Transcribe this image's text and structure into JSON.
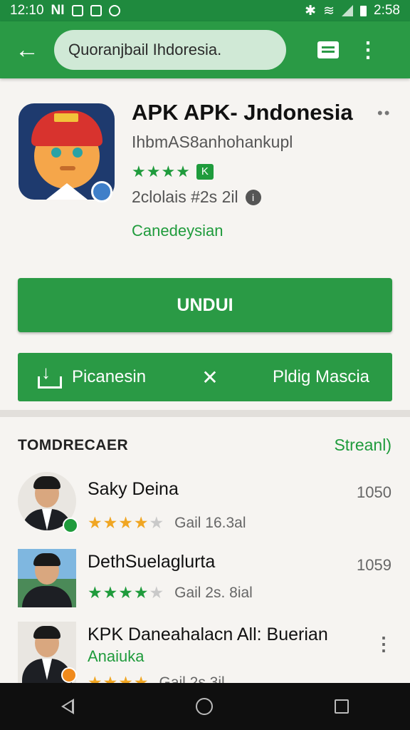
{
  "status_bar": {
    "time": "12:10",
    "carrier": "NI",
    "right_time": "2:58"
  },
  "app_bar": {
    "search_text": "Quoranjbail Ihdoresia."
  },
  "app": {
    "title": "APK APK- Jndonesia",
    "developer": "IhbmAS8anhohankupl",
    "stars": "★★★★",
    "badge": "K",
    "downloads": "2clolais #2s 2il",
    "category": "Canedeysian"
  },
  "buttons": {
    "install": "UNDUI",
    "left_action": "Picanesin",
    "separator": "✕",
    "right_action": "Pldig Mascia"
  },
  "section": {
    "title": "TOMDRECAER",
    "link": "Streanl)"
  },
  "list": [
    {
      "name": "Saky Deina",
      "rating_text": "Gail 16.3al",
      "number": "1050",
      "star_color": "#f0a623",
      "badge_color": "#1f9b3c"
    },
    {
      "name": "DethSuelaglurta",
      "rating_text": "Gail 2s. 8ial",
      "number": "1059",
      "star_color": "#1f9b3c"
    },
    {
      "name": "KPK Daneahalacn All: Buerian",
      "subtitle": "Anaiuka",
      "rating_text": "Gail 2s 3il",
      "badge_color": "#f08a1c"
    }
  ],
  "colors": {
    "primary": "#2a9a45",
    "status_bar": "#1f8a3e",
    "accent_green": "#1f9b3c",
    "star_gold": "#f0a623"
  },
  "icons": [
    "back-arrow",
    "document",
    "more-vertical",
    "info",
    "download",
    "close"
  ]
}
